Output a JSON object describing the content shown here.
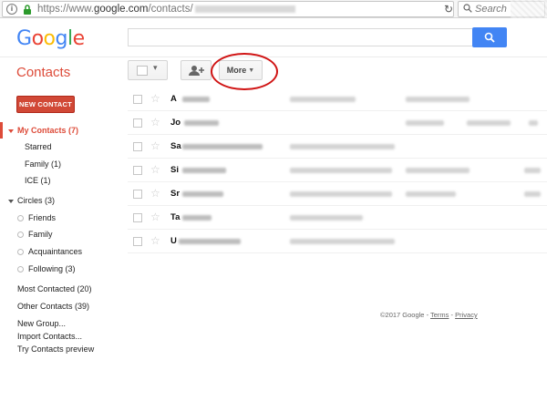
{
  "browser": {
    "url_prefix": "https://www.",
    "url_domain": "google.com",
    "url_path": "/contacts/",
    "search_placeholder": "Search"
  },
  "logo": [
    "G",
    "o",
    "o",
    "g",
    "l",
    "e"
  ],
  "section_title": "Contacts",
  "toolbar": {
    "more_label": "More"
  },
  "sidebar": {
    "new_contact": "NEW CONTACT",
    "my_contacts": "My Contacts (7)",
    "starred": "Starred",
    "family": "Family (1)",
    "ice": "ICE (1)",
    "circles": "Circles (3)",
    "circle_items": [
      "Friends",
      "Family",
      "Acquaintances",
      "Following (3)"
    ],
    "most_contacted": "Most Contacted (20)",
    "other_contacts": "Other Contacts (39)",
    "new_group": "New Group...",
    "import_contacts": "Import Contacts...",
    "try_preview": "Try Contacts preview"
  },
  "contacts": [
    {
      "initial": "A"
    },
    {
      "initial": "Jo"
    },
    {
      "initial": "Sa"
    },
    {
      "initial": "Si"
    },
    {
      "initial": "Sr"
    },
    {
      "initial": "Ta"
    },
    {
      "initial": "U"
    }
  ],
  "footer": {
    "copyright": "©2017 Google - ",
    "terms": "Terms",
    "sep": " - ",
    "privacy": "Privacy"
  },
  "colors": {
    "accent": "#dd4b39",
    "primary_button": "#4285f4",
    "annotation": "#d01414"
  }
}
